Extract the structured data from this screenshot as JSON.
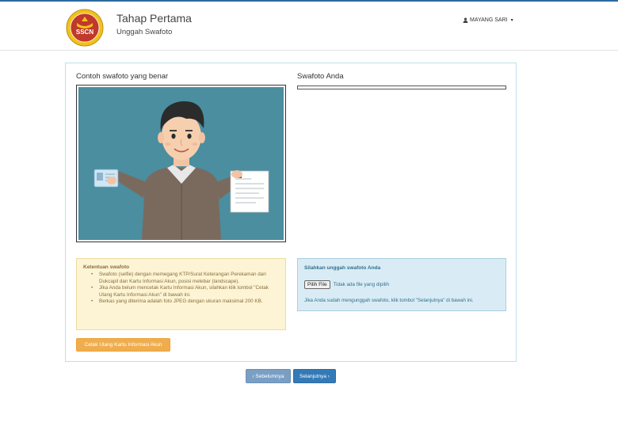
{
  "header": {
    "logo_text": "SSCN",
    "title": "Tahap Pertama",
    "subtitle": "Unggah Swafoto",
    "user_name": "MAYANG SARI",
    "user_icon": "user-icon",
    "caret": "▾"
  },
  "left": {
    "title": "Contoh swafoto yang benar",
    "rules_title": "Ketentuan swafoto",
    "rules": [
      "Swafoto (selfie) dengan memegang KTP/Surat Keterangan Perekaman dari Dukcapil dan Kartu Informasi Akun, posisi melebar (landscape).",
      "Jika Anda belum mencetak Kartu Informasi Akun, silahkan klik tombol \"Cetak Ulang Kartu Informasi Akun\" di bawah ini.",
      "Berkas yang diterima adalah foto JPEG dengan ukuran maksimal 200 KB."
    ],
    "print_button": "Cetak Ulang Kartu Informasi Akun"
  },
  "right": {
    "title": "Swafoto Anda",
    "upload_title": "Silahkan unggah swafoto Anda",
    "file_button": "Pilih File",
    "file_status": "Tidak ada file yang dipilih",
    "note": "Jika Anda sudah mengunggah swafoto, klik tombol \"Selanjutnya\" di bawah ini."
  },
  "nav": {
    "prev": "‹ Sebelumnya",
    "next": "Selanjutnya ›"
  },
  "colors": {
    "primary": "#337ab7",
    "warning": "#f0ad4e",
    "sample_bg": "#4a8ea0"
  }
}
